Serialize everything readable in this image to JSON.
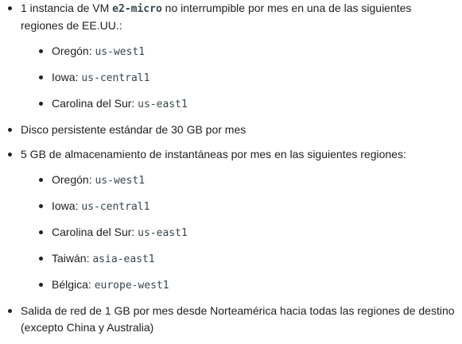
{
  "items": [
    {
      "text_before": "1 instancia de VM ",
      "code": "e2-micro",
      "text_after": " no interrumpible por mes en una de las siguientes regiones de EE.UU.:",
      "subitems": [
        {
          "label": "Oregón: ",
          "code": "us-west1"
        },
        {
          "label": "Iowa: ",
          "code": "us-central1"
        },
        {
          "label": "Carolina del Sur: ",
          "code": "us-east1"
        }
      ]
    },
    {
      "text": "Disco persistente estándar de 30 GB por mes"
    },
    {
      "text": "5 GB de almacenamiento de instantáneas por mes en las siguientes regiones:",
      "subitems": [
        {
          "label": "Oregón: ",
          "code": "us-west1"
        },
        {
          "label": "Iowa: ",
          "code": "us-central1"
        },
        {
          "label": "Carolina del Sur: ",
          "code": "us-east1"
        },
        {
          "label": "Taiwán: ",
          "code": "asia-east1"
        },
        {
          "label": "Bélgica: ",
          "code": "europe-west1"
        }
      ]
    },
    {
      "text": "Salida de red de 1 GB por mes desde Norteamérica hacia todas las regiones de destino (excepto China y Australia)"
    }
  ]
}
